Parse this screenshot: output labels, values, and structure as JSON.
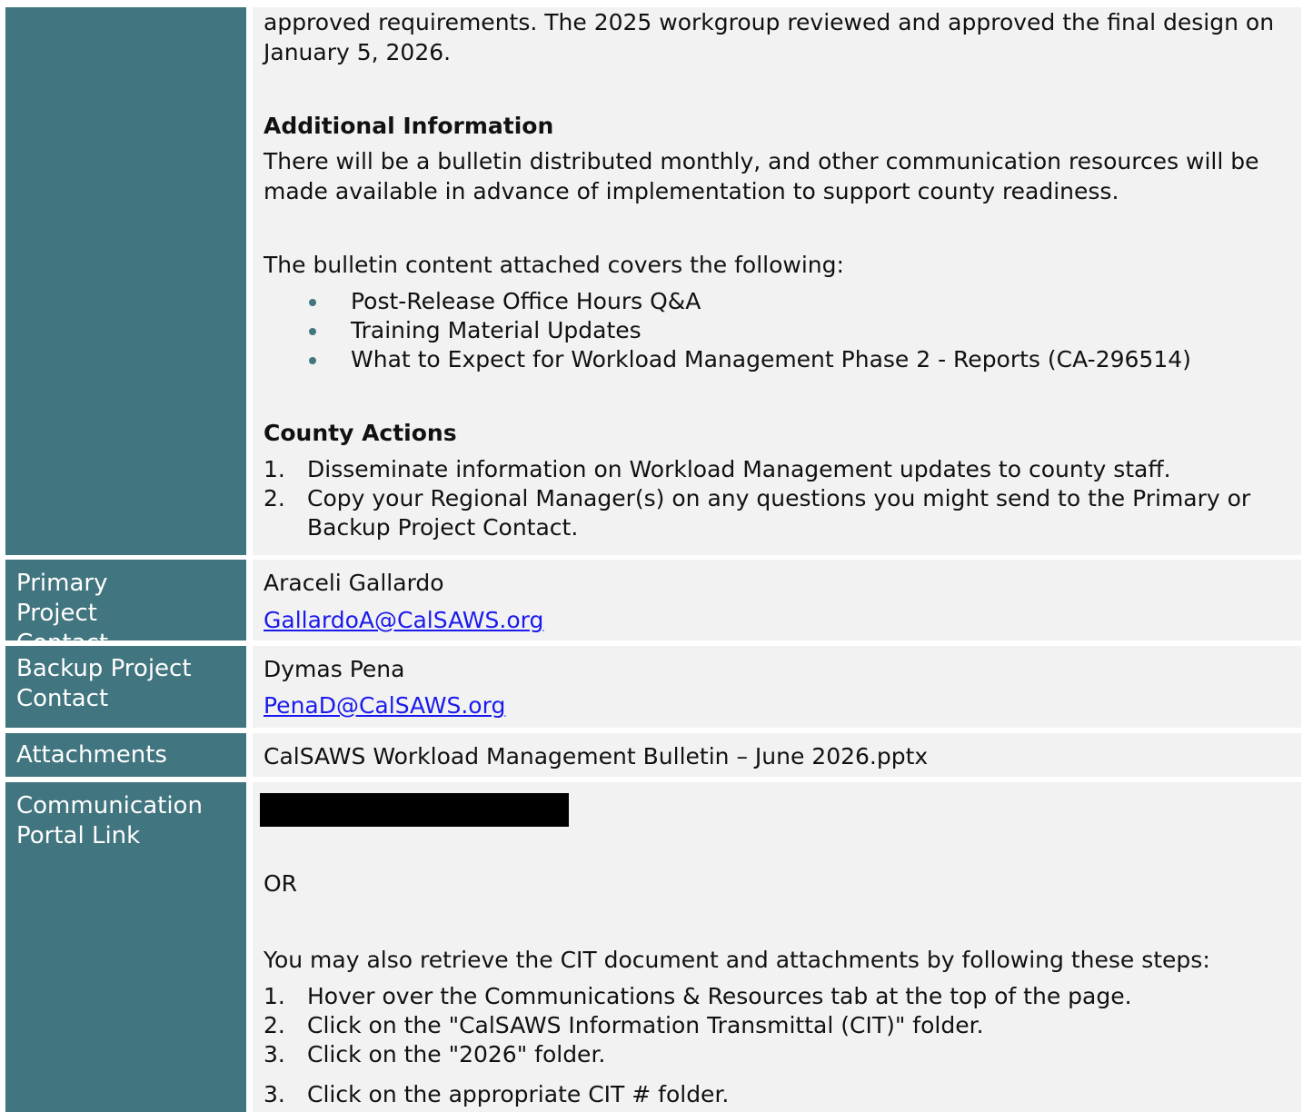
{
  "main_section": {
    "intro_text": "approved requirements. The 2025 workgroup reviewed and approved the final design on January 5, 2026.",
    "additional_info": {
      "heading": "Additional Information",
      "body": "There will be a bulletin distributed monthly, and other communication resources will be made available in advance of implementation to support county readiness.",
      "covers_intro": "The bulletin content attached covers the following:",
      "bullets": [
        "Post-Release Office Hours Q&A",
        "Training Material Updates",
        "What to Expect for Workload Management Phase 2 - Reports (CA-296514)"
      ]
    },
    "county_actions": {
      "heading": "County Actions",
      "items": [
        {
          "num": "1.",
          "text": "Disseminate information on Workload Management updates to county staff."
        },
        {
          "num": "2.",
          "text": "Copy your Regional Manager(s) on any questions you might send to the Primary or Backup Project Contact."
        }
      ]
    }
  },
  "primary_contact": {
    "label": "Primary Project Contact",
    "name": "Araceli Gallardo",
    "email": "GallardoA@CalSAWS.org"
  },
  "backup_contact": {
    "label": "Backup Project Contact",
    "name": "Dymas Pena",
    "email": "PenaD@CalSAWS.org"
  },
  "attachments": {
    "label": "Attachments",
    "file": "CalSAWS Workload Management Bulletin – June 2026.pptx"
  },
  "portal": {
    "label": "Communication Portal Link",
    "or_text": "OR",
    "steps_intro": "You may also retrieve the CIT document and attachments by following these steps:",
    "steps": [
      {
        "num": "1.",
        "text": "Hover over the Communications & Resources tab at the top of the page."
      },
      {
        "num": "2.",
        "text": "Click on the \"CalSAWS Information Transmittal (CIT)\" folder."
      },
      {
        "num": "3.",
        "text": "Click on the \"2026\" folder."
      },
      {
        "num": "3.",
        "text": "Click on the appropriate CIT # folder."
      }
    ]
  },
  "colors": {
    "label_bg": "#41757f",
    "cell_bg": "#f2f2f2",
    "link": "#1a1aee"
  }
}
